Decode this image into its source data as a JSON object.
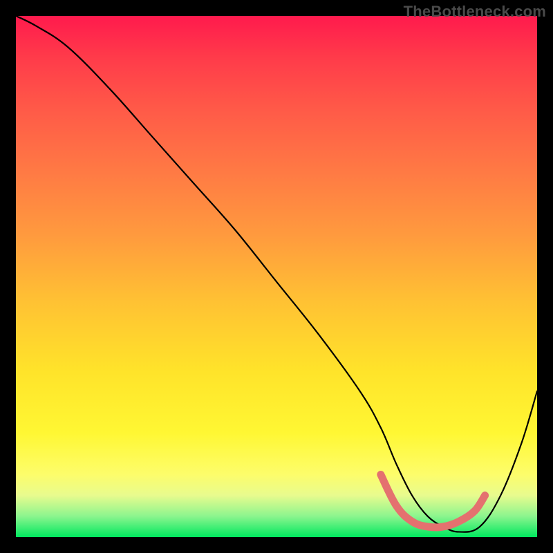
{
  "watermark": "TheBottleneck.com",
  "chart_data": {
    "type": "line",
    "title": "",
    "xlabel": "",
    "ylabel": "",
    "xlim": [
      0,
      100
    ],
    "ylim": [
      0,
      100
    ],
    "grid": false,
    "series": [
      {
        "name": "bottleneck-curve",
        "color": "#000000",
        "x": [
          0,
          4,
          10,
          18,
          26,
          34,
          42,
          50,
          58,
          66,
          70,
          73,
          76,
          79,
          82,
          85,
          89,
          93,
          97,
          100
        ],
        "y": [
          100,
          98,
          94,
          86,
          77,
          68,
          59,
          49,
          39,
          28,
          21,
          14,
          8,
          4,
          2,
          1,
          2,
          8,
          18,
          28
        ]
      },
      {
        "name": "optimal-range-marker",
        "color": "#e4716f",
        "x": [
          70,
          73,
          76,
          79,
          82,
          85,
          88,
          90
        ],
        "y": [
          12,
          6,
          3,
          2,
          2,
          3,
          5,
          8
        ]
      }
    ],
    "background_gradient": {
      "top": "#ff1a4d",
      "mid": "#ffe32a",
      "bottom": "#00e85f"
    }
  }
}
